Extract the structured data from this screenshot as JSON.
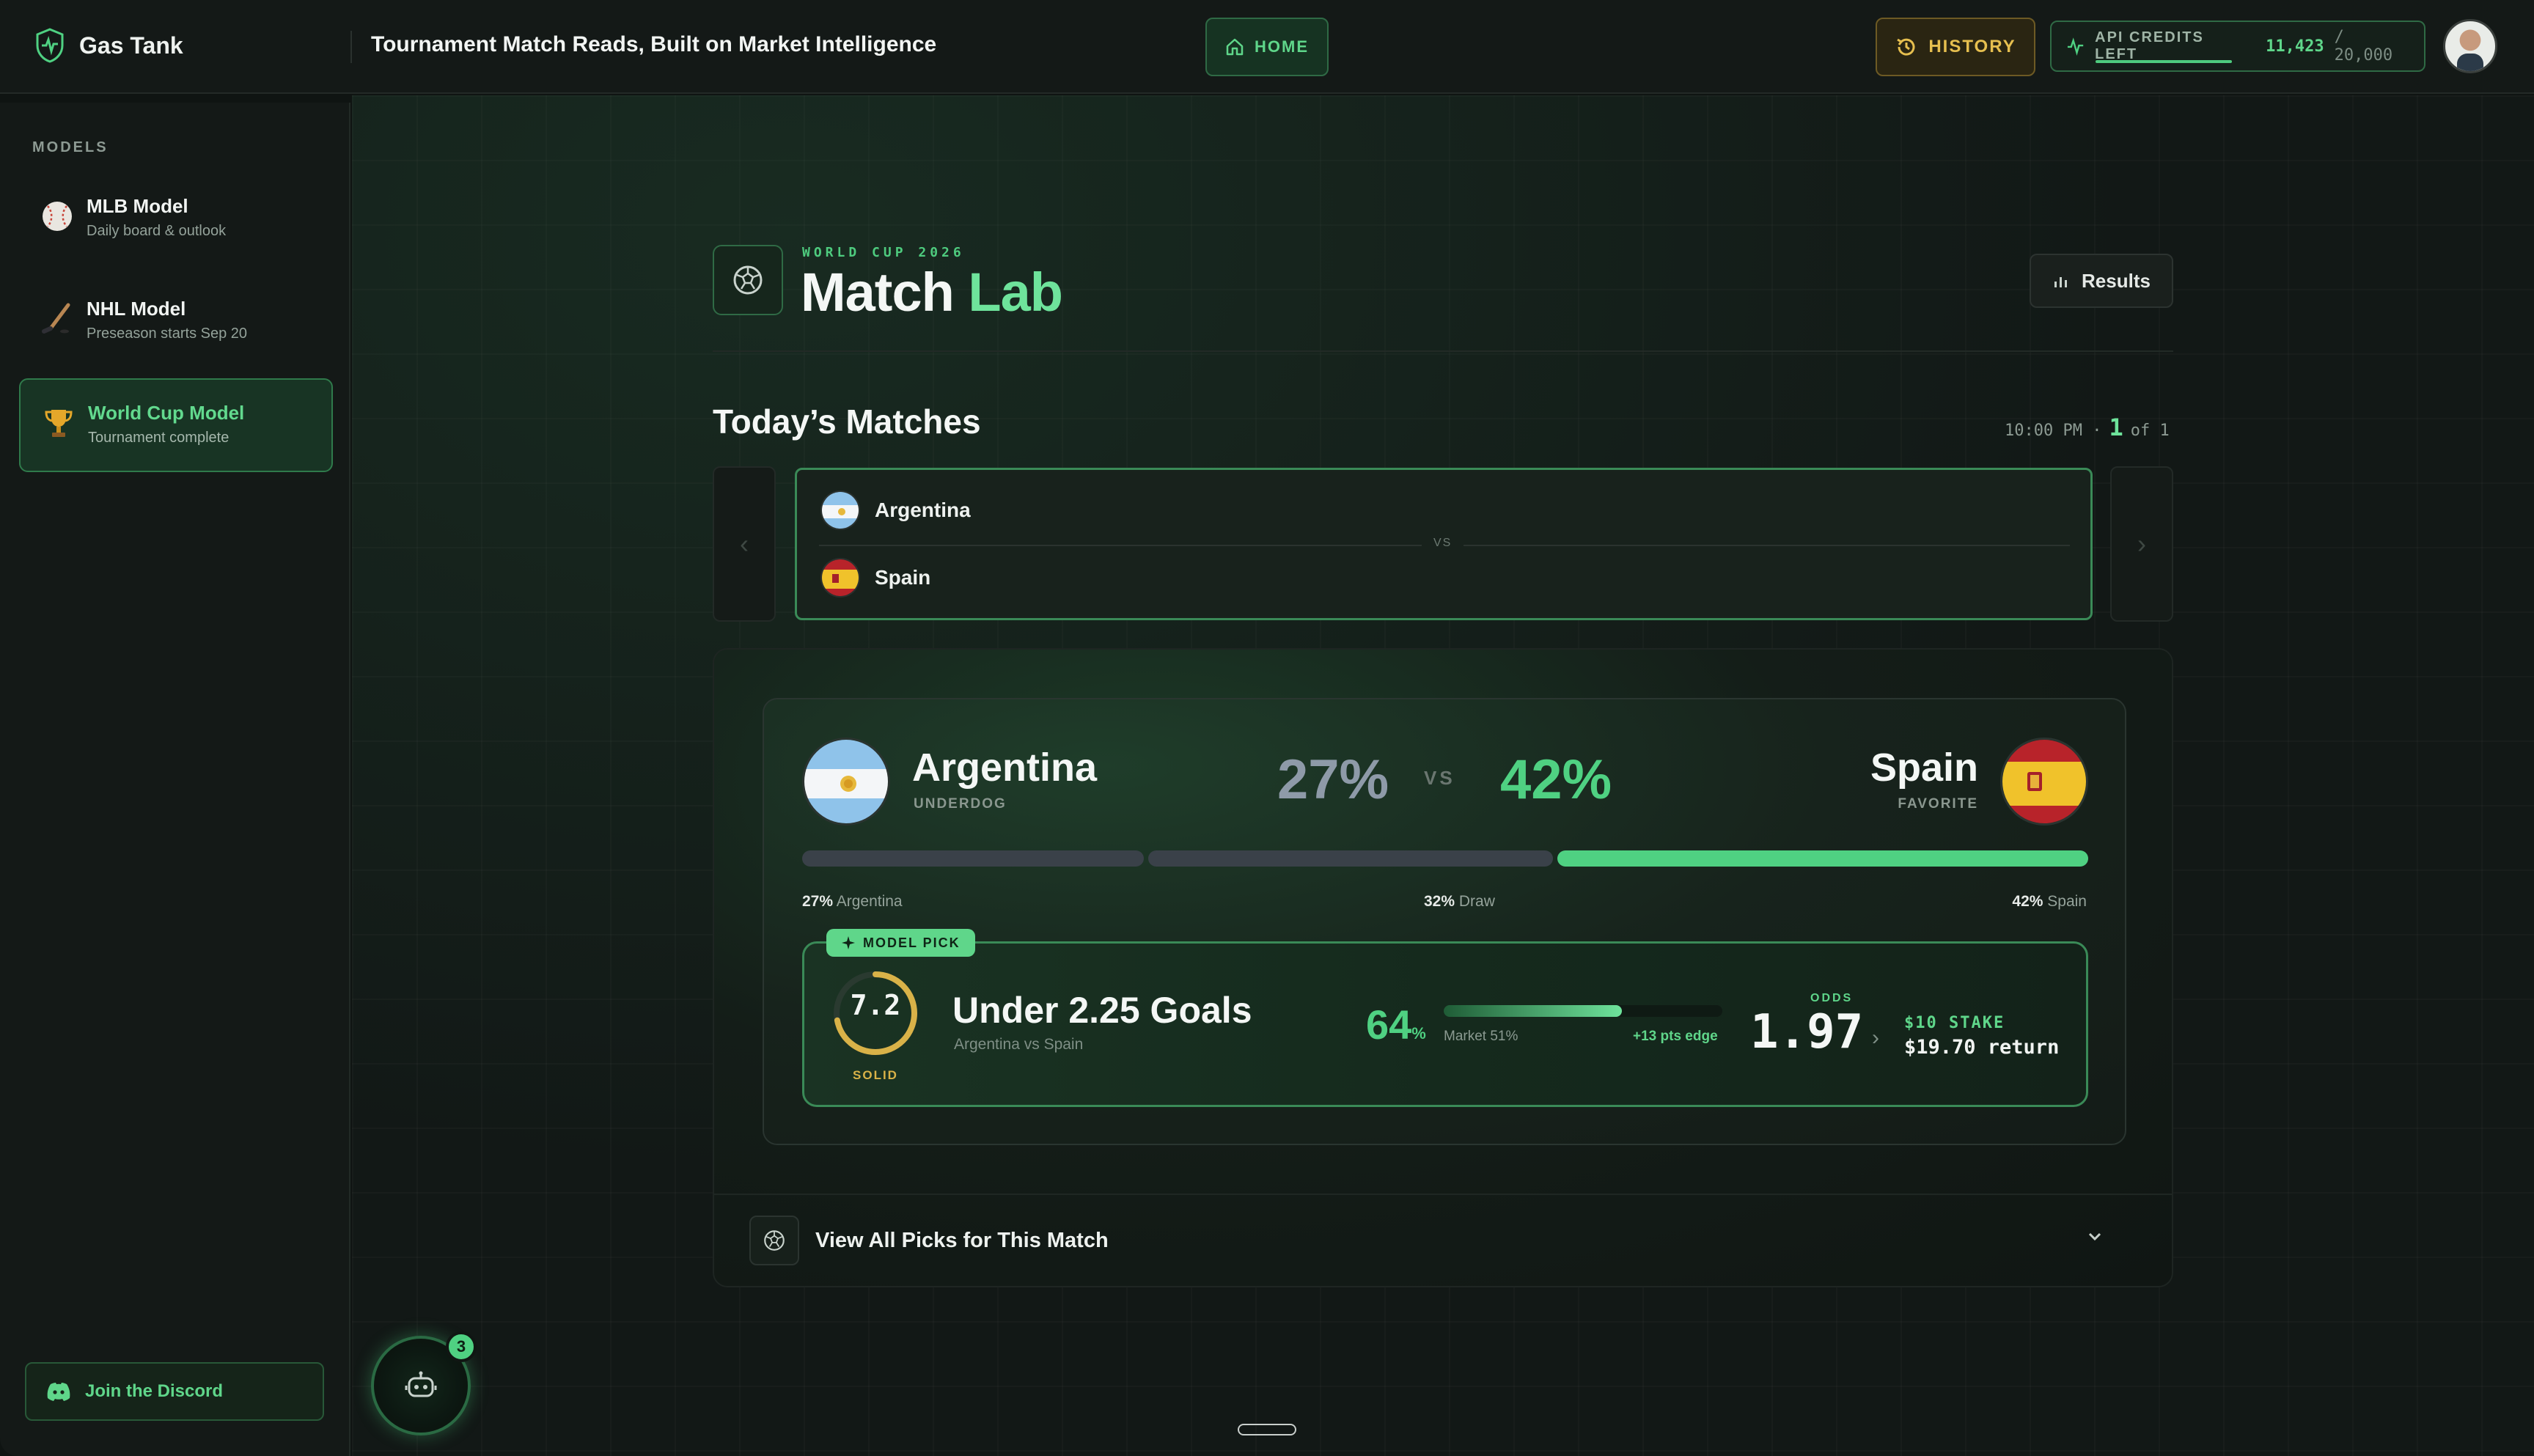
{
  "app": {
    "brand": "Gas Tank",
    "title": "Tournament Match Reads, Built on Market Intelligence"
  },
  "topbar": {
    "home_label": "HOME",
    "history_label": "HISTORY",
    "credits_label": "API CREDITS LEFT",
    "credits_value": "11,423",
    "credits_total": "/ 20,000",
    "credits_fraction": 0.571
  },
  "sidebar": {
    "section_label": "MODELS",
    "items": [
      {
        "title": "MLB Model",
        "subtitle": "Daily board & outlook",
        "icon": "baseball-icon"
      },
      {
        "title": "NHL Model",
        "subtitle": "Preseason starts Sep 20",
        "icon": "hockey-stick-icon"
      },
      {
        "title": "World Cup Model",
        "subtitle": "Tournament complete",
        "icon": "trophy-icon",
        "active": true
      }
    ],
    "discord_label": "Join the Discord"
  },
  "lab": {
    "eyebrow": "WORLD CUP 2026",
    "title_main": "Match",
    "title_accent": "Lab",
    "results_label": "Results"
  },
  "today": {
    "title": "Today’s Matches",
    "time": "10:00 PM ·",
    "page": "1",
    "of": "of 1",
    "home_team": "Argentina",
    "away_team": "Spain",
    "vs": "VS"
  },
  "match": {
    "home": {
      "name": "Argentina",
      "tag": "UNDERDOG",
      "pct": "27%"
    },
    "away": {
      "name": "Spain",
      "tag": "FAVORITE",
      "pct": "42%"
    },
    "vs": "VS",
    "probabilities": {
      "home": 27,
      "draw": 32,
      "away": 42
    },
    "labels": {
      "home_pct": "27%",
      "home_name": "Argentina",
      "draw_pct": "32%",
      "draw_name": "Draw",
      "away_pct": "42%",
      "away_name": "Spain"
    }
  },
  "pick": {
    "badge": "MODEL PICK",
    "score": "7.2",
    "score_fraction": 0.72,
    "score_tag": "SOLID",
    "title": "Under 2.25 Goals",
    "subtitle": "Argentina vs Spain",
    "confidence": "64",
    "confidence_unit": "%",
    "market_label": "Market 51%",
    "edge_label": "+13 pts edge",
    "model_prob": 0.64,
    "market_prob": 0.51,
    "odds_label": "ODDS",
    "odds": "1.97",
    "stake": "$10 STAKE",
    "return": "$19.70 return"
  },
  "footer": {
    "view_all": "View All Picks for This Match"
  },
  "bot": {
    "badge": "3"
  },
  "colors": {
    "accent_green": "#4fd182",
    "gold": "#e6bf4f",
    "underdog_grey": "#8e9aa8"
  }
}
